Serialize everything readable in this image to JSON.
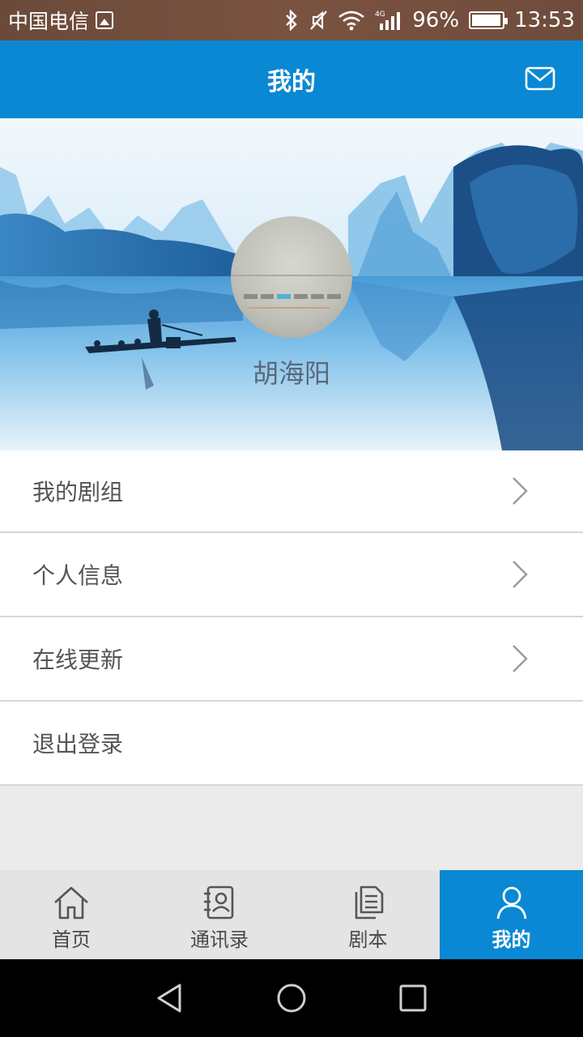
{
  "status_bar": {
    "carrier": "中国电信",
    "battery_percent": "96%",
    "battery_level": 0.96,
    "time": "13:53",
    "network": "4G"
  },
  "header": {
    "title": "我的",
    "action_icon": "mail-icon"
  },
  "profile": {
    "username": "胡海阳"
  },
  "menu": {
    "items": [
      {
        "label": "我的剧组",
        "chevron": true
      },
      {
        "label": "个人信息",
        "chevron": true
      },
      {
        "label": "在线更新",
        "chevron": true
      },
      {
        "label": "退出登录",
        "chevron": false
      }
    ]
  },
  "bottom_nav": {
    "items": [
      {
        "label": "首页",
        "icon": "home-icon",
        "active": false
      },
      {
        "label": "通讯录",
        "icon": "contacts-icon",
        "active": false
      },
      {
        "label": "剧本",
        "icon": "script-icon",
        "active": false
      },
      {
        "label": "我的",
        "icon": "user-icon",
        "active": true
      }
    ]
  },
  "colors": {
    "accent": "#0a88d4",
    "status_bar": "#6e4c3c",
    "background": "#ebebeb"
  }
}
